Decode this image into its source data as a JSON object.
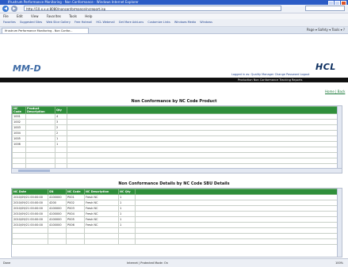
{
  "window": {
    "title": "Ifrustrum Performance Monitoring - Non Conformance - Windows Internet Explorer"
  },
  "navigation": {
    "address": "http://10.x.x.x:8080/nonconformance/ncreport.jsp",
    "back_glyph": "◀",
    "forward_glyph": "▶"
  },
  "menu": {
    "items": [
      "File",
      "Edit",
      "View",
      "Favorites",
      "Tools",
      "Help"
    ]
  },
  "favorites": {
    "items": [
      "Favorites",
      "Suggested Sites",
      "Web Slice Gallery",
      "Free Hotmail",
      "HCL Webmail",
      "Get More Add-ons",
      "Customize Links",
      "Windows Media",
      "Windows"
    ]
  },
  "tab": {
    "label": "Ifrustrum Performance Monitoring - Non Confor..."
  },
  "toolbar": {
    "items": "Page ▾  Safety ▾  Tools ▾  ?"
  },
  "header": {
    "app_logo": "MM-D",
    "company_logo": "HCL",
    "user_info": "Logged in as: Quality Manager   Change Password   Logout"
  },
  "topbar": {
    "text": "Production   Non Conformance   Tracking   Reports"
  },
  "home_link": "Home | Back",
  "section1": {
    "title": "Non Conformance by NC Code Product",
    "columns": [
      "NC Code",
      "Product Description",
      "Qty"
    ],
    "rows": [
      [
        "1001",
        "",
        "4"
      ],
      [
        "1002",
        "",
        "3"
      ],
      [
        "1003",
        "",
        "2"
      ],
      [
        "1004",
        "",
        "2"
      ],
      [
        "1005",
        "",
        "1"
      ],
      [
        "1006",
        "",
        "1"
      ],
      [
        "",
        "",
        ""
      ],
      [
        "",
        "",
        ""
      ],
      [
        "",
        "",
        ""
      ],
      [
        "",
        "",
        ""
      ]
    ]
  },
  "section2": {
    "title": "Non Conformance Details by NC Code SBU Details",
    "columns": [
      "NC Date",
      "SN",
      "NC Code",
      "NC Description",
      "NC Qty"
    ],
    "rows": [
      [
        "2010/09/21 00:00:00",
        "4100000",
        "P001",
        "Fresh NC",
        "1"
      ],
      [
        "2010/09/21 00:00:00",
        "4200",
        "P002",
        "Fresh NC",
        "1"
      ],
      [
        "2010/09/21 00:00:00",
        "4100000",
        "P003",
        "Fresh NC",
        "1"
      ],
      [
        "2010/09/21 00:00:00",
        "4100000",
        "P004",
        "Fresh NC",
        "1"
      ],
      [
        "2010/09/21 00:00:00",
        "4100000",
        "P005",
        "Fresh NC",
        "1"
      ],
      [
        "2010/09/21 00:00:00",
        "4100000",
        "P006",
        "Fresh NC",
        "1"
      ],
      [
        "",
        "",
        "",
        "",
        ""
      ],
      [
        "",
        "",
        "",
        "",
        ""
      ],
      [
        "",
        "",
        "",
        "",
        ""
      ]
    ]
  },
  "status": {
    "left": "Done",
    "middle": "Internet | Protected Mode: On",
    "right": "100%"
  }
}
